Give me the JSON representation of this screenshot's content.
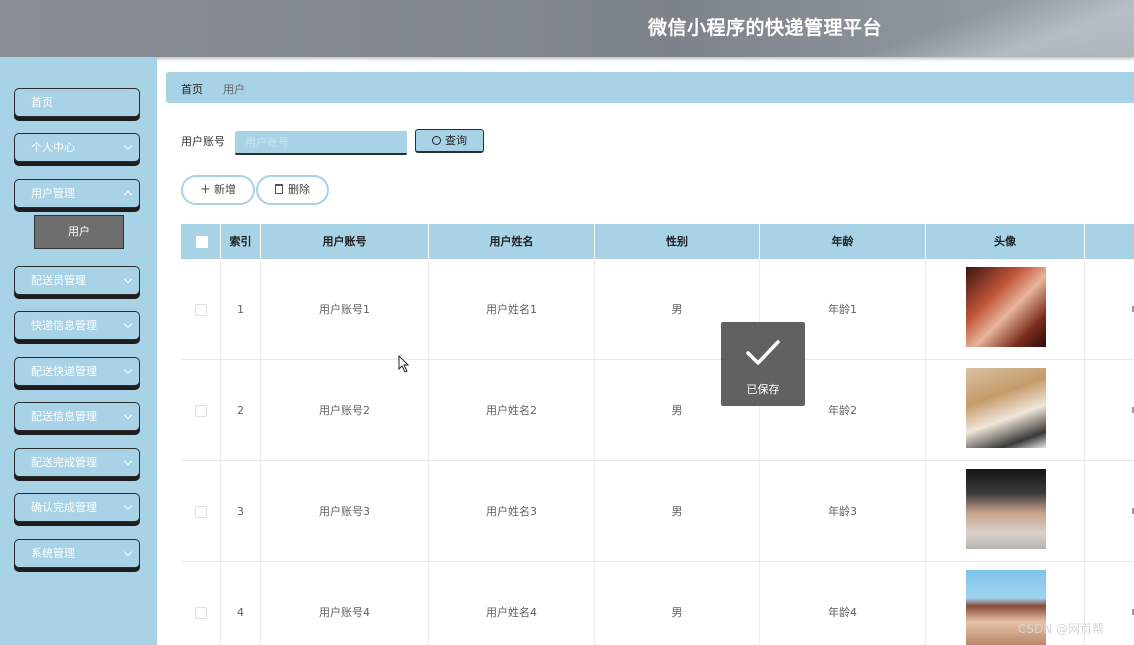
{
  "header": {
    "title": "微信小程序的快递管理平台"
  },
  "sidebar": {
    "items": [
      {
        "label": "首页"
      },
      {
        "label": "个人中心"
      },
      {
        "label": "用户管理"
      },
      {
        "label": "配送员管理"
      },
      {
        "label": "快递信息管理"
      },
      {
        "label": "配送快递管理"
      },
      {
        "label": "配送信息管理"
      },
      {
        "label": "配送完成管理"
      },
      {
        "label": "确认完成管理"
      },
      {
        "label": "系统管理"
      }
    ],
    "active_sub": "用户"
  },
  "breadcrumb": {
    "home": "首页",
    "current": "用户"
  },
  "search": {
    "label": "用户账号",
    "placeholder": "用户账号",
    "button": "查询"
  },
  "actions": {
    "add": "新增",
    "delete": "删除"
  },
  "table": {
    "headers": [
      "索引",
      "用户账号",
      "用户姓名",
      "性别",
      "年龄",
      "头像"
    ],
    "rows": [
      {
        "index": "1",
        "account": "用户账号1",
        "name": "用户姓名1",
        "gender": "男",
        "age": "年龄1"
      },
      {
        "index": "2",
        "account": "用户账号2",
        "name": "用户姓名2",
        "gender": "男",
        "age": "年龄2"
      },
      {
        "index": "3",
        "account": "用户账号3",
        "name": "用户姓名3",
        "gender": "男",
        "age": "年龄3"
      },
      {
        "index": "4",
        "account": "用户账号4",
        "name": "用户姓名4",
        "gender": "男",
        "age": "年龄4"
      }
    ]
  },
  "toast": {
    "message": "已保存"
  },
  "watermark": "CSDN @网页帮",
  "colors": {
    "accent": "#a8d2e6",
    "header": "#7d838a",
    "toast": "#505050"
  }
}
